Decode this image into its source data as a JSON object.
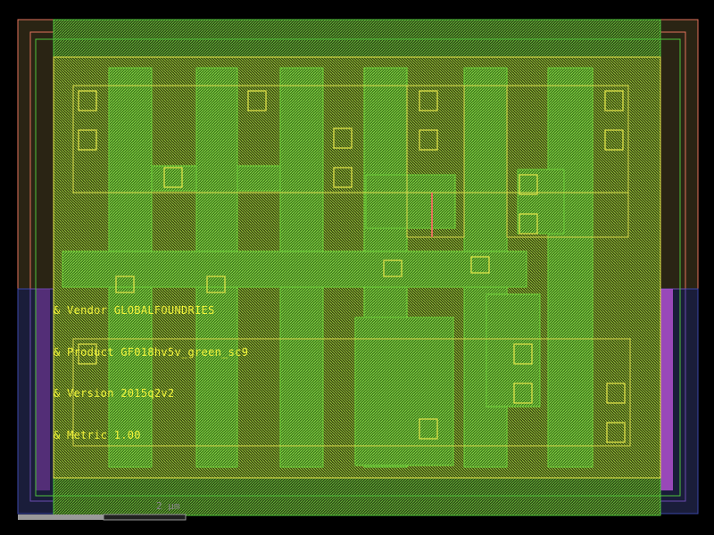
{
  "labels": {
    "vendor": "& Vendor GLOBALFOUNDRIES",
    "product": "& Product GF018hv5v_green_sc9",
    "version": "& Version 2015q2v2",
    "metric": "& Metric 1.00"
  },
  "scale": {
    "text": "2 µm"
  },
  "colors": {
    "background": "#000000",
    "nwell": "#e2725b",
    "pwell": "#3b46a8",
    "metal_purple": "#c060e0",
    "poly_green": "#4fc23a",
    "diff_yellow": "#e6e64a",
    "label_text": "#f2f23a",
    "scale_bar": "#8a8a8a"
  }
}
